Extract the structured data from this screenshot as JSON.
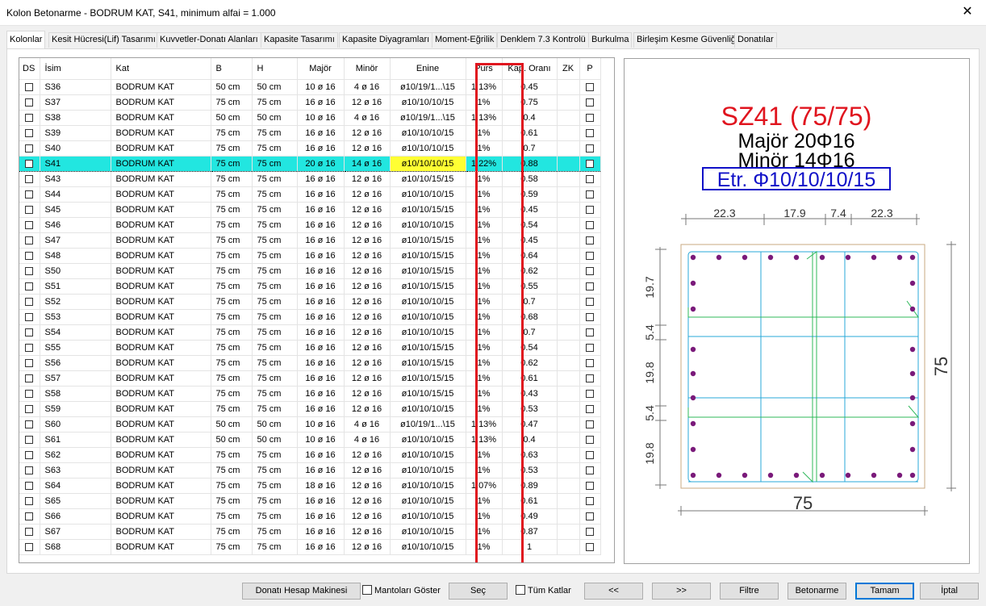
{
  "window": {
    "title": "Kolon Betonarme - BODRUM KAT, S41, minimum alfai = 1.000"
  },
  "tabs": [
    {
      "label": "Kolonlar"
    },
    {
      "label": "Kesit Hücresi(Lif) Tasarımı"
    },
    {
      "label": "Kuvvetler-Donatı Alanları"
    },
    {
      "label": "Kapasite Tasarımı"
    },
    {
      "label": "Kapasite Diyagramları"
    },
    {
      "label": "Moment-Eğrilik"
    },
    {
      "label": "Denklem 7.3 Kontrolü"
    },
    {
      "label": "Burkulma"
    },
    {
      "label": "Birleşim Kesme Güvenliği"
    },
    {
      "label": "Donatılar"
    }
  ],
  "columns": [
    "DS",
    "İsim",
    "Kat",
    "B",
    "H",
    "Majör",
    "Minör",
    "Enine",
    "Purs",
    "Kap. Oranı",
    "ZK",
    "P"
  ],
  "rows": [
    [
      "S36",
      "BODRUM KAT",
      "50 cm",
      "50 cm",
      "10 ø 16",
      "4 ø 16",
      "ø10/19/1...\\15",
      "1.13%",
      "0.45"
    ],
    [
      "S37",
      "BODRUM KAT",
      "75 cm",
      "75 cm",
      "16 ø 16",
      "12 ø 16",
      "ø10/10/10/15",
      "1%",
      "0.75"
    ],
    [
      "S38",
      "BODRUM KAT",
      "50 cm",
      "50 cm",
      "10 ø 16",
      "4 ø 16",
      "ø10/19/1...\\15",
      "1.13%",
      "0.4"
    ],
    [
      "S39",
      "BODRUM KAT",
      "75 cm",
      "75 cm",
      "16 ø 16",
      "12 ø 16",
      "ø10/10/10/15",
      "1%",
      "0.61"
    ],
    [
      "S40",
      "BODRUM KAT",
      "75 cm",
      "75 cm",
      "16 ø 16",
      "12 ø 16",
      "ø10/10/10/15",
      "1%",
      "0.7"
    ],
    [
      "S41",
      "BODRUM KAT",
      "75 cm",
      "75 cm",
      "20 ø 16",
      "14 ø 16",
      "ø10/10/10/15",
      "1.22%",
      "0.88"
    ],
    [
      "S43",
      "BODRUM KAT",
      "75 cm",
      "75 cm",
      "16 ø 16",
      "12 ø 16",
      "ø10/10/15/15",
      "1%",
      "0.58"
    ],
    [
      "S44",
      "BODRUM KAT",
      "75 cm",
      "75 cm",
      "16 ø 16",
      "12 ø 16",
      "ø10/10/10/15",
      "1%",
      "0.59"
    ],
    [
      "S45",
      "BODRUM KAT",
      "75 cm",
      "75 cm",
      "16 ø 16",
      "12 ø 16",
      "ø10/10/15/15",
      "1%",
      "0.45"
    ],
    [
      "S46",
      "BODRUM KAT",
      "75 cm",
      "75 cm",
      "16 ø 16",
      "12 ø 16",
      "ø10/10/10/15",
      "1%",
      "0.54"
    ],
    [
      "S47",
      "BODRUM KAT",
      "75 cm",
      "75 cm",
      "16 ø 16",
      "12 ø 16",
      "ø10/10/15/15",
      "1%",
      "0.45"
    ],
    [
      "S48",
      "BODRUM KAT",
      "75 cm",
      "75 cm",
      "16 ø 16",
      "12 ø 16",
      "ø10/10/15/15",
      "1%",
      "0.64"
    ],
    [
      "S50",
      "BODRUM KAT",
      "75 cm",
      "75 cm",
      "16 ø 16",
      "12 ø 16",
      "ø10/10/15/15",
      "1%",
      "0.62"
    ],
    [
      "S51",
      "BODRUM KAT",
      "75 cm",
      "75 cm",
      "16 ø 16",
      "12 ø 16",
      "ø10/10/15/15",
      "1%",
      "0.55"
    ],
    [
      "S52",
      "BODRUM KAT",
      "75 cm",
      "75 cm",
      "16 ø 16",
      "12 ø 16",
      "ø10/10/10/15",
      "1%",
      "0.7"
    ],
    [
      "S53",
      "BODRUM KAT",
      "75 cm",
      "75 cm",
      "16 ø 16",
      "12 ø 16",
      "ø10/10/10/15",
      "1%",
      "0.68"
    ],
    [
      "S54",
      "BODRUM KAT",
      "75 cm",
      "75 cm",
      "16 ø 16",
      "12 ø 16",
      "ø10/10/10/15",
      "1%",
      "0.7"
    ],
    [
      "S55",
      "BODRUM KAT",
      "75 cm",
      "75 cm",
      "16 ø 16",
      "12 ø 16",
      "ø10/10/15/15",
      "1%",
      "0.54"
    ],
    [
      "S56",
      "BODRUM KAT",
      "75 cm",
      "75 cm",
      "16 ø 16",
      "12 ø 16",
      "ø10/10/15/15",
      "1%",
      "0.62"
    ],
    [
      "S57",
      "BODRUM KAT",
      "75 cm",
      "75 cm",
      "16 ø 16",
      "12 ø 16",
      "ø10/10/15/15",
      "1%",
      "0.61"
    ],
    [
      "S58",
      "BODRUM KAT",
      "75 cm",
      "75 cm",
      "16 ø 16",
      "12 ø 16",
      "ø10/10/15/15",
      "1%",
      "0.43"
    ],
    [
      "S59",
      "BODRUM KAT",
      "75 cm",
      "75 cm",
      "16 ø 16",
      "12 ø 16",
      "ø10/10/10/15",
      "1%",
      "0.53"
    ],
    [
      "S60",
      "BODRUM KAT",
      "50 cm",
      "50 cm",
      "10 ø 16",
      "4 ø 16",
      "ø10/19/1...\\15",
      "1.13%",
      "0.47"
    ],
    [
      "S61",
      "BODRUM KAT",
      "50 cm",
      "50 cm",
      "10 ø 16",
      "4 ø 16",
      "ø10/10/10/15",
      "1.13%",
      "0.4"
    ],
    [
      "S62",
      "BODRUM KAT",
      "75 cm",
      "75 cm",
      "16 ø 16",
      "12 ø 16",
      "ø10/10/10/15",
      "1%",
      "0.63"
    ],
    [
      "S63",
      "BODRUM KAT",
      "75 cm",
      "75 cm",
      "16 ø 16",
      "12 ø 16",
      "ø10/10/10/15",
      "1%",
      "0.53"
    ],
    [
      "S64",
      "BODRUM KAT",
      "75 cm",
      "75 cm",
      "18 ø 16",
      "12 ø 16",
      "ø10/10/10/15",
      "1.07%",
      "0.89"
    ],
    [
      "S65",
      "BODRUM KAT",
      "75 cm",
      "75 cm",
      "16 ø 16",
      "12 ø 16",
      "ø10/10/10/15",
      "1%",
      "0.61"
    ],
    [
      "S66",
      "BODRUM KAT",
      "75 cm",
      "75 cm",
      "16 ø 16",
      "12 ø 16",
      "ø10/10/10/15",
      "1%",
      "0.49"
    ],
    [
      "S67",
      "BODRUM KAT",
      "75 cm",
      "75 cm",
      "16 ø 16",
      "12 ø 16",
      "ø10/10/10/15",
      "1%",
      "0.87"
    ],
    [
      "S68",
      "BODRUM KAT",
      "75 cm",
      "75 cm",
      "16 ø 16",
      "12 ø 16",
      "ø10/10/10/15",
      "1%",
      "1"
    ]
  ],
  "selected_row": "S41",
  "section": {
    "title": "SZ41 (75/75)",
    "major": "Majör 20Φ16",
    "minor": "Minör 14Φ16",
    "stirrup": "Etr. Φ10/10/10/15",
    "dim_top": [
      "22.3",
      "17.9",
      "7.4",
      "22.3"
    ],
    "dim_left": [
      "19.7",
      "5.4",
      "19.8",
      "5.4",
      "19.8"
    ],
    "width_label": "75",
    "height_label": "75"
  },
  "buttons": {
    "calc": "Donatı Hesap Makinesi",
    "show_jackets": "Mantoları Göster",
    "select": "Seç",
    "all_floors": "Tüm Katlar",
    "prev": "<<",
    "next": ">>",
    "filter": "Filtre",
    "concrete": "Betonarme",
    "ok": "Tamam",
    "cancel": "İptal"
  },
  "colors": {
    "selection": "#22e6e0",
    "highlight_border": "#e0141e",
    "section_title": "#e0141e",
    "stirrup_box": "#1010c8",
    "bar": "#7a1a7a",
    "rebar_line": "#2aa8d8"
  }
}
